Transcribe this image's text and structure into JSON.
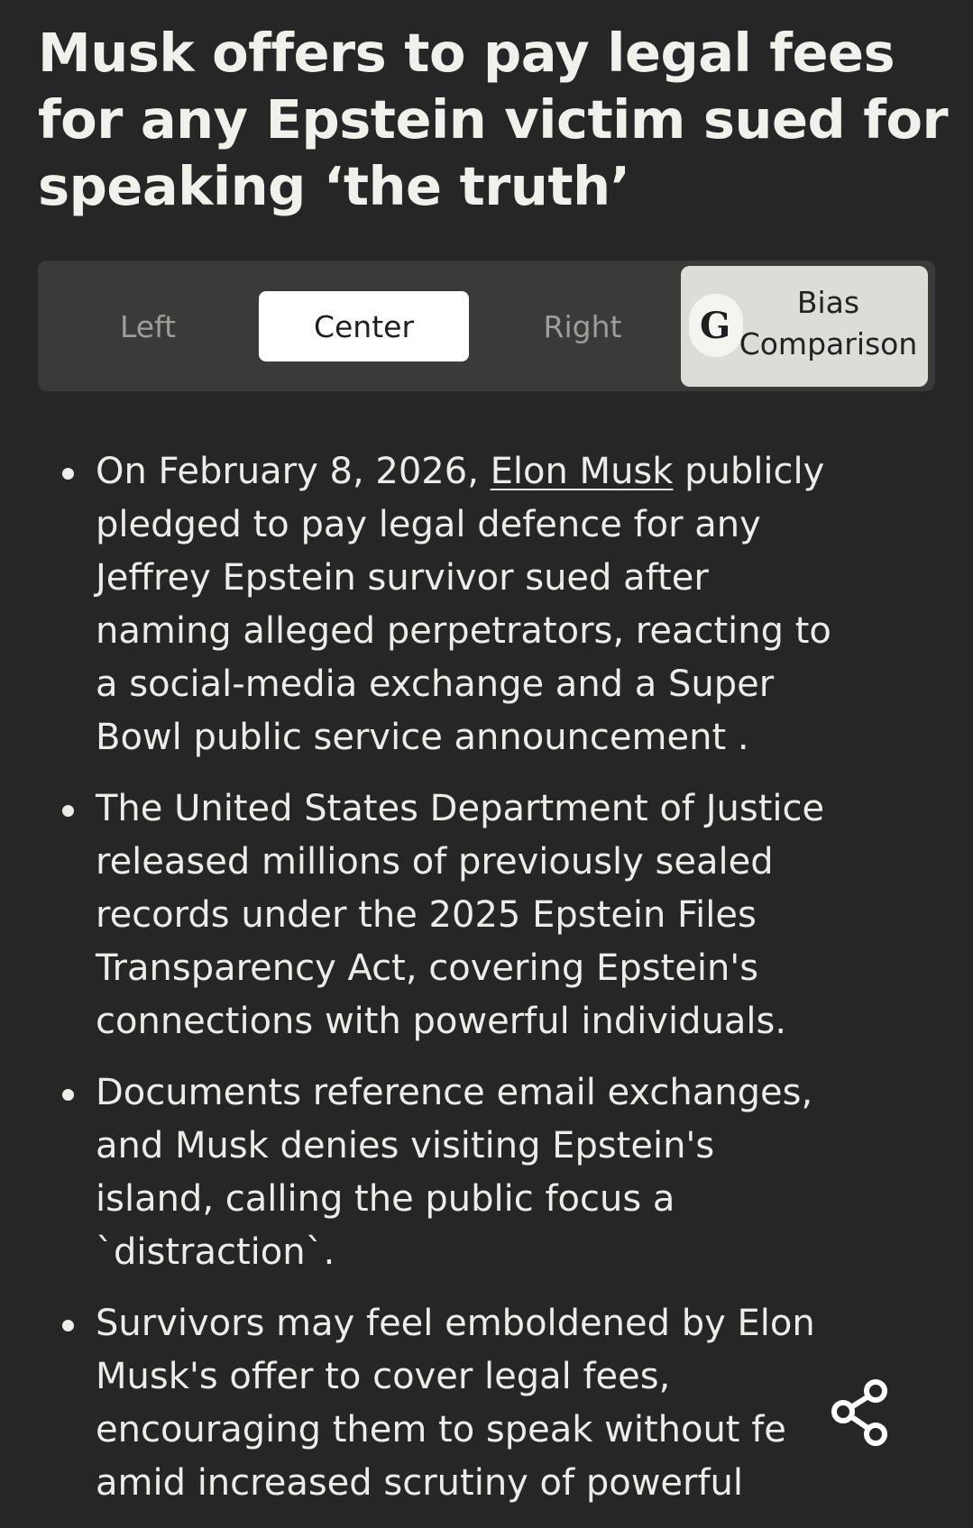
{
  "article": {
    "title": "Musk offers to pay legal fees for any Epstein victim sued for speaking ‘the truth’"
  },
  "tabs": {
    "left": "Left",
    "center": "Center",
    "right": "Right",
    "selected": "Center",
    "bias_line1": "Bias",
    "bias_line2": "Comparison",
    "bias_logo_glyph": "G",
    "bias_logo_icon": "ground-news-logo-icon"
  },
  "bullets": {
    "b1": {
      "l1_pre": "On February 8, 2026, ",
      "l1_link": "Elon Musk",
      "l1_post": " publicly",
      "l2": "pledged to pay legal defence for any",
      "l3": "Jeffrey Epstein survivor sued after",
      "l4": "naming alleged perpetrators, reacting to",
      "l5": "a social-media exchange and a Super",
      "l6": "Bowl public service announcement ."
    },
    "b2": {
      "l1": "The United States Department of Justice",
      "l2": "released millions of previously sealed",
      "l3": "records under the 2025 Epstein Files",
      "l4": "Transparency Act, covering Epstein's",
      "l5": "connections with powerful individuals."
    },
    "b3": {
      "l1": "Documents reference email exchanges,",
      "l2": "and Musk denies visiting Epstein's",
      "l3": "island, calling the public focus a",
      "l4": " `distraction`."
    },
    "b4": {
      "l1": "Survivors may feel emboldened by Elon",
      "l2": "Musk's offer to cover legal fees,",
      "l3": "encouraging them to speak without fe",
      "l4": "amid increased scrutiny of powerful"
    }
  },
  "icons": {
    "share": "share-icon"
  },
  "colors": {
    "background": "#262626",
    "text": "#ececea",
    "tabbar": "#3a3a38",
    "tab_selected": "#ffffff",
    "bias_button": "#dcdcd8"
  }
}
